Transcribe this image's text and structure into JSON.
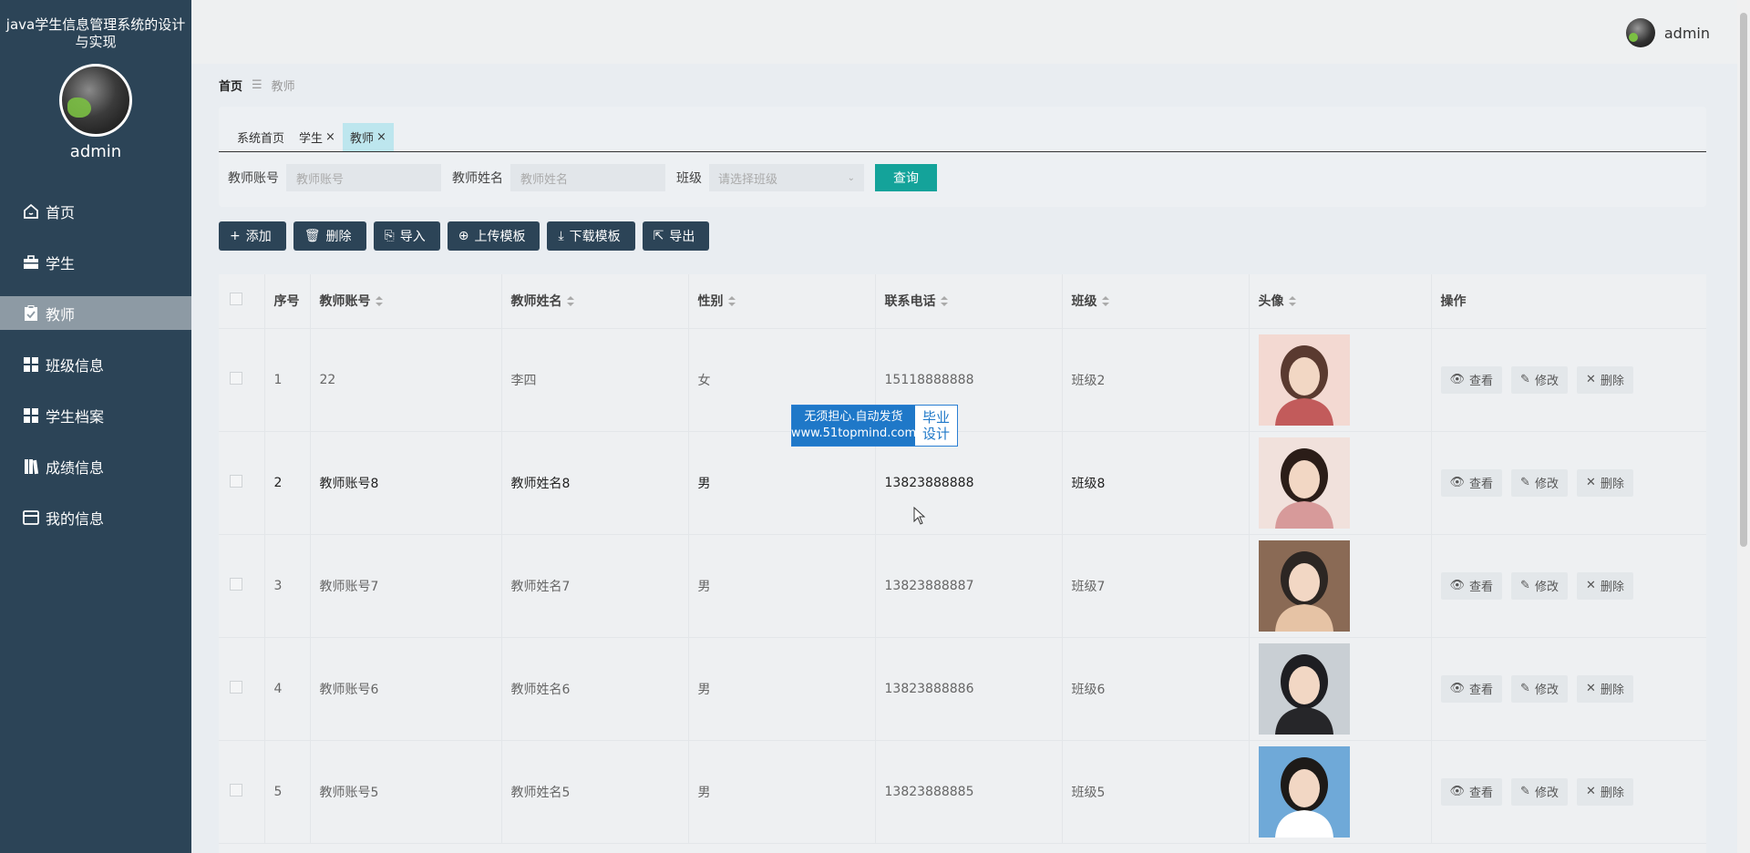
{
  "sidebar": {
    "title": "java学生信息管理系统的设计与实现",
    "username": "admin",
    "items": [
      {
        "label": "首页",
        "icon": "home-icon"
      },
      {
        "label": "学生",
        "icon": "briefcase-icon"
      },
      {
        "label": "教师",
        "icon": "clipboard-icon"
      },
      {
        "label": "班级信息",
        "icon": "grid-icon"
      },
      {
        "label": "学生档案",
        "icon": "grid-icon"
      },
      {
        "label": "成绩信息",
        "icon": "book-icon"
      },
      {
        "label": "我的信息",
        "icon": "card-icon"
      }
    ],
    "active_index": 2
  },
  "topbar": {
    "username": "admin"
  },
  "breadcrumb": {
    "home": "首页",
    "separator": "☰",
    "current": "教师"
  },
  "tabs": [
    {
      "label": "系统首页",
      "closable": false
    },
    {
      "label": "学生",
      "closable": true
    },
    {
      "label": "教师",
      "closable": true,
      "active": true
    }
  ],
  "search": {
    "account_label": "教师账号",
    "account_placeholder": "教师账号",
    "name_label": "教师姓名",
    "name_placeholder": "教师姓名",
    "class_label": "班级",
    "class_placeholder": "请选择班级",
    "query_button": "查询"
  },
  "toolbar": {
    "add": "添加",
    "delete": "删除",
    "import": "导入",
    "upload_template": "上传模板",
    "download_template": "下载模板",
    "export": "导出"
  },
  "table": {
    "headers": {
      "index": "序号",
      "account": "教师账号",
      "name": "教师姓名",
      "gender": "性别",
      "phone": "联系电话",
      "class": "班级",
      "avatar": "头像",
      "actions": "操作"
    },
    "rows": [
      {
        "index": "1",
        "account": "22",
        "name": "李四",
        "gender": "女",
        "phone": "15118888888",
        "class": "班级2"
      },
      {
        "index": "2",
        "account": "教师账号8",
        "name": "教师姓名8",
        "gender": "男",
        "phone": "13823888888",
        "class": "班级8"
      },
      {
        "index": "3",
        "account": "教师账号7",
        "name": "教师姓名7",
        "gender": "男",
        "phone": "13823888887",
        "class": "班级7"
      },
      {
        "index": "4",
        "account": "教师账号6",
        "name": "教师姓名6",
        "gender": "男",
        "phone": "13823888886",
        "class": "班级6"
      },
      {
        "index": "5",
        "account": "教师账号5",
        "name": "教师姓名5",
        "gender": "男",
        "phone": "13823888885",
        "class": "班级5"
      }
    ],
    "row_actions": {
      "view": "查看",
      "edit": "修改",
      "delete": "删除"
    }
  },
  "watermark": {
    "line1": "无须担心.自动发货",
    "line2": "www.51topmind.com",
    "right1": "毕业",
    "right2": "设计"
  },
  "colors": {
    "sidebar": "#2c4457",
    "active_menu": "#8d9aa4",
    "query_button": "#14a39a",
    "active_tab": "#bde6ee"
  }
}
